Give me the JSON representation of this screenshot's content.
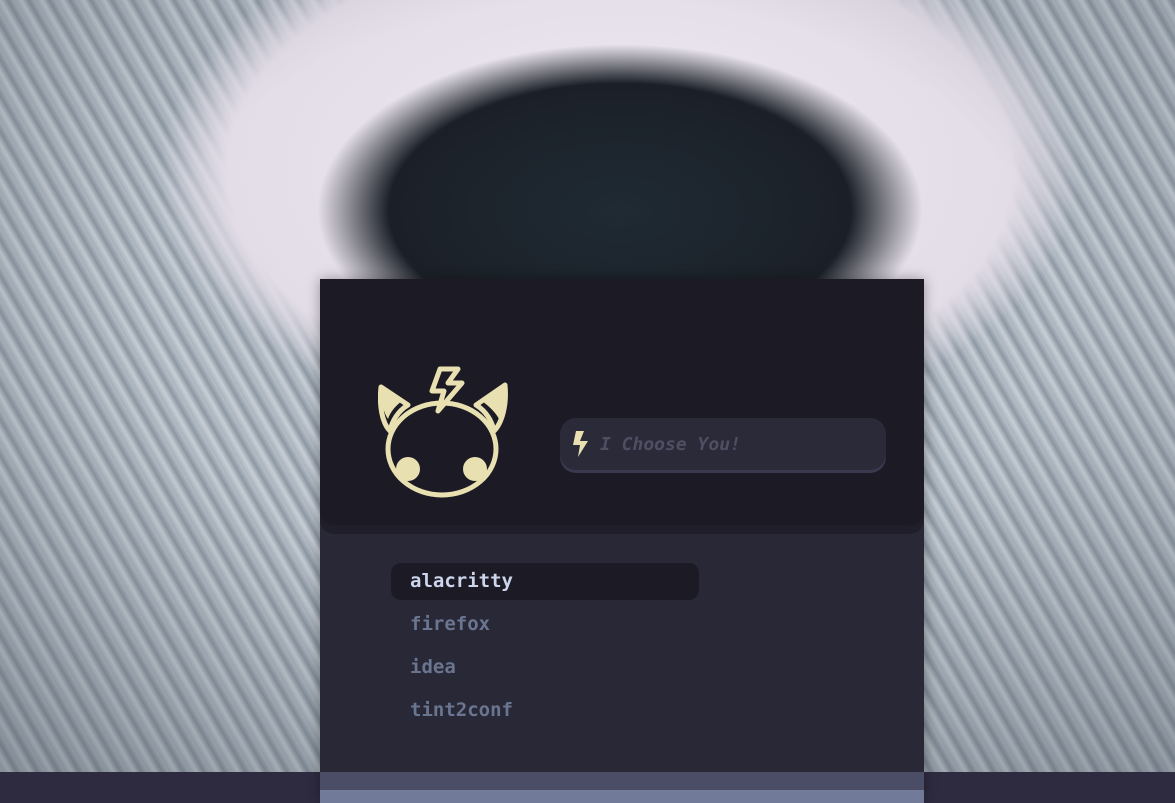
{
  "launcher": {
    "search": {
      "placeholder": "I Choose You!",
      "value": ""
    },
    "apps": [
      {
        "label": "alacritty",
        "selected": true
      },
      {
        "label": "firefox",
        "selected": false
      },
      {
        "label": "idea",
        "selected": false
      },
      {
        "label": "tint2conf",
        "selected": false
      }
    ],
    "icons": {
      "logo": "pikachu-logo-icon",
      "search": "lightning-bolt-icon"
    }
  },
  "colors": {
    "accent": "#e8e0b0",
    "header_bg": "#1c1b25",
    "body_bg": "#292837",
    "selected_text": "#cdd5ec",
    "item_text": "#6a7590"
  }
}
